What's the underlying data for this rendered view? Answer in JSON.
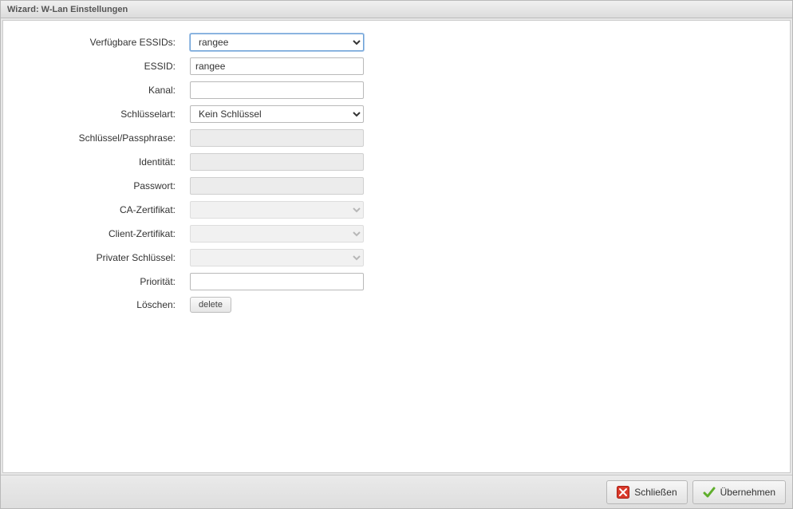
{
  "window": {
    "title": "Wizard: W-Lan Einstellungen"
  },
  "form": {
    "labels": {
      "available_essids": "Verfügbare ESSIDs:",
      "essid": "ESSID:",
      "channel": "Kanal:",
      "key_type": "Schlüsselart:",
      "passphrase": "Schlüssel/Passphrase:",
      "identity": "Identität:",
      "password": "Passwort:",
      "ca_cert": "CA-Zertifikat:",
      "client_cert": "Client-Zertifikat:",
      "private_key": "Privater Schlüssel:",
      "priority": "Priorität:",
      "delete": "Löschen:"
    },
    "values": {
      "available_essids_selected": "rangee",
      "essid": "rangee",
      "channel": "",
      "key_type_selected": "Kein Schlüssel",
      "passphrase": "",
      "identity": "",
      "password": "",
      "ca_cert_selected": "",
      "client_cert_selected": "",
      "private_key_selected": "",
      "priority": ""
    },
    "buttons": {
      "delete": "delete"
    }
  },
  "footer": {
    "close": "Schließen",
    "apply": "Übernehmen"
  }
}
